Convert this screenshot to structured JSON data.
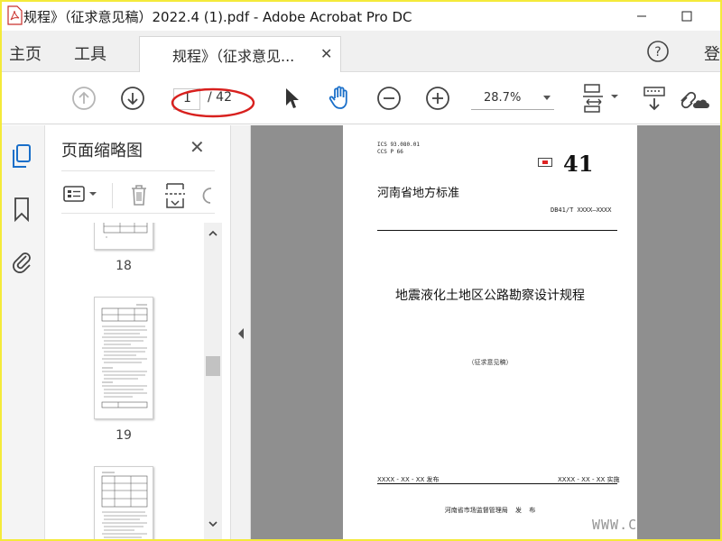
{
  "window": {
    "title": "规程》（征求意见稿）2022.4 (1).pdf - Adobe Acrobat Pro DC"
  },
  "nav": {
    "home": "主页",
    "tools": "工具",
    "doc_tab": "规程》（征求意见...",
    "signin": "登"
  },
  "toolbar": {
    "current_page": "1",
    "total_pages": "/ 42",
    "zoom": "28.7%"
  },
  "panel": {
    "title": "页面缩略图",
    "thumbnails": [
      {
        "number": "18"
      },
      {
        "number": "19"
      }
    ]
  },
  "page": {
    "ics": "ICS  93.080.01",
    "ccs": "CCS   P 66",
    "std_number": "41",
    "header": "河南省地方标准",
    "code": "DB41/T XXXX—XXXX",
    "title": "地震液化土地区公路勘察设计规程",
    "subtitle": "（征求意见稿）",
    "publish_date": "XXXX - XX - XX 发布",
    "implement_date": "XXXX - XX - XX 实施",
    "publisher": "河南省市场监督管理局   发 布"
  },
  "watermark": "WWW.C",
  "colors": {
    "accent_blue": "#1a6fc9",
    "annotation_red": "#d8201e",
    "border_yellow": "#f4ea3a"
  }
}
